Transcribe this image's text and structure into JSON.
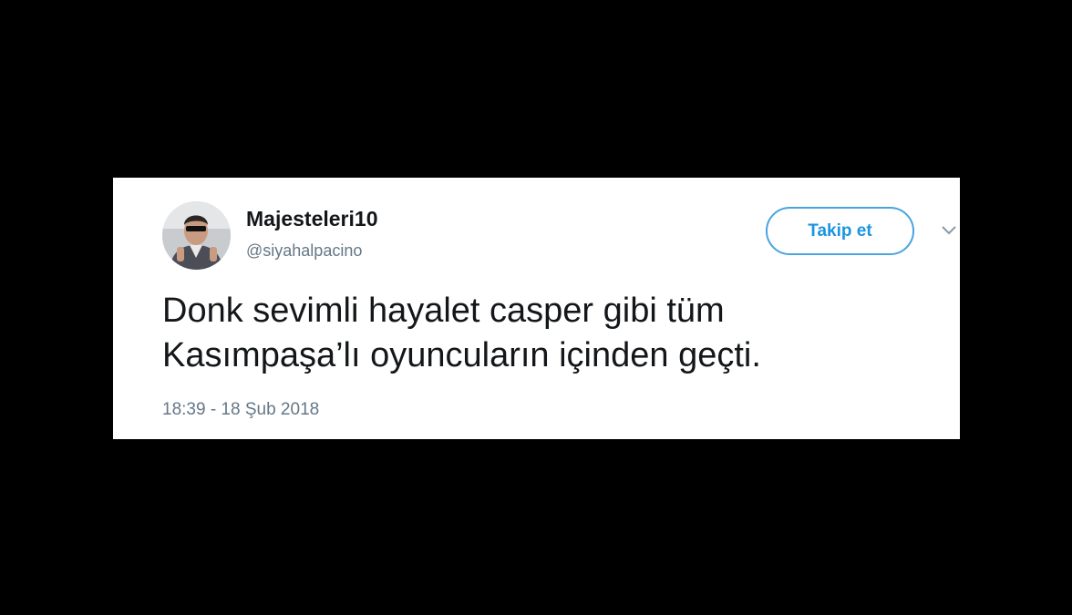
{
  "tweet": {
    "display_name": "Majesteleri10",
    "handle": "@siyahalpacino",
    "follow_label": "Takip et",
    "text_line_1": "Donk sevimli hayalet casper gibi tüm",
    "text_line_2": "Kasımpaşa’lı oyuncuların içinden geçti.",
    "timestamp": "18:39 - 18 Şub 2018"
  },
  "icons": {
    "avatar": "profile-photo",
    "menu": "chevron-down-icon"
  },
  "colors": {
    "background": "#000000",
    "card": "#ffffff",
    "accent": "#1b95e0",
    "text": "#14171a",
    "secondary_text": "#657786"
  }
}
